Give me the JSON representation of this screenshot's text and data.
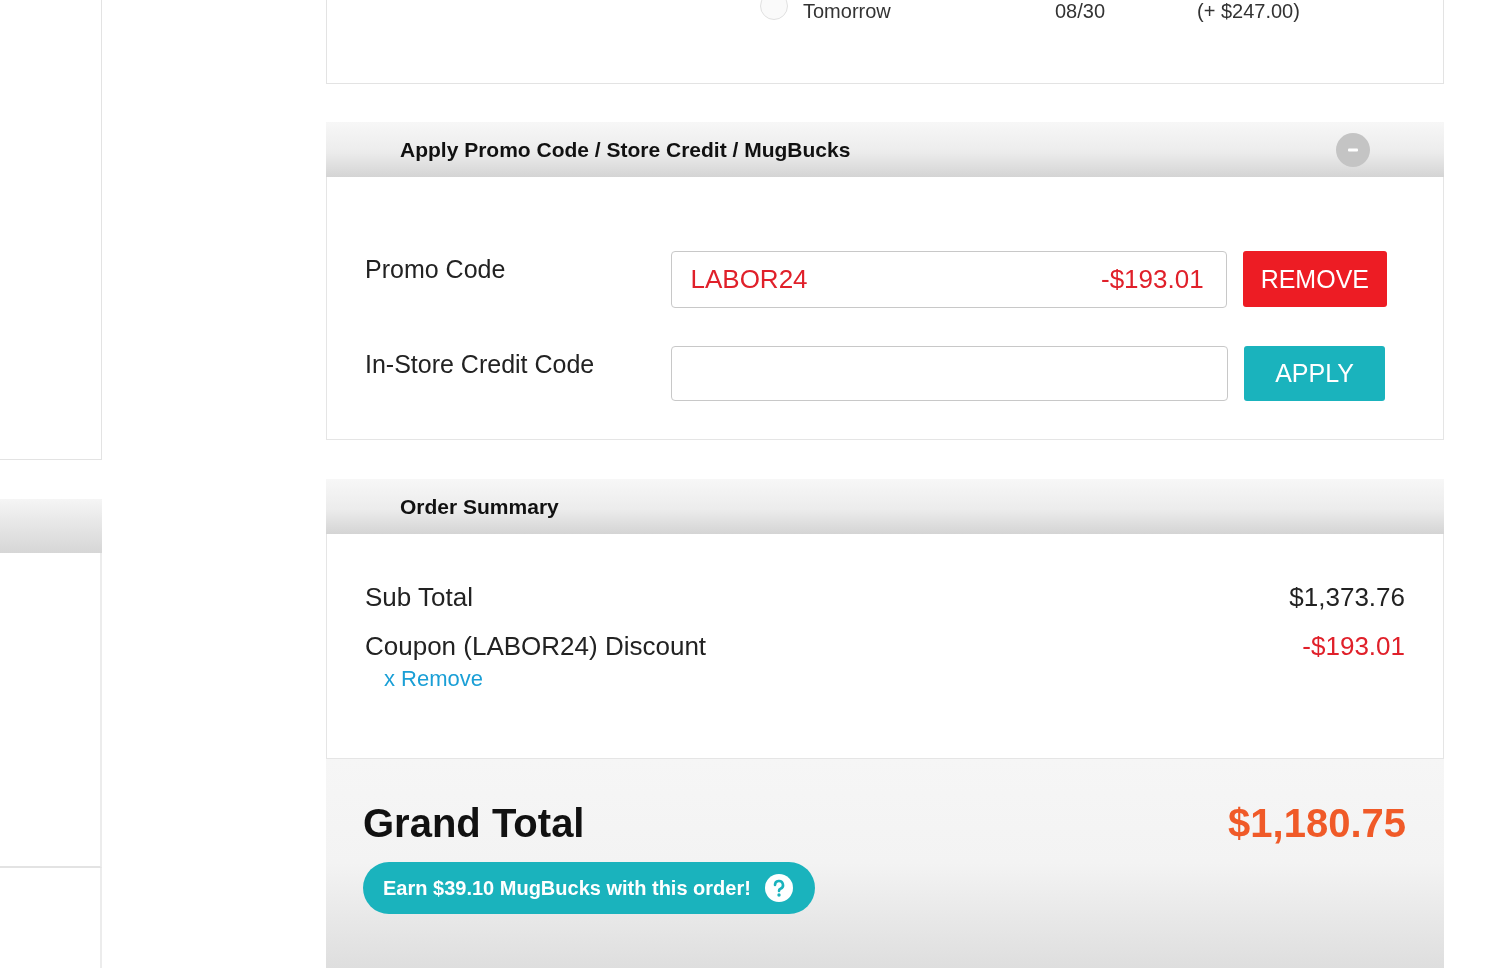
{
  "delivery_option": {
    "selected": false,
    "label": "Tomorrow",
    "date": "08/30",
    "price": "(+ $247.00)"
  },
  "promo_panel": {
    "title": "Apply Promo Code / Store Credit / MugBucks",
    "expanded": true,
    "rows": [
      {
        "kind": "applied",
        "label": "Promo Code",
        "value": "LABOR24",
        "amount": "-$193.01",
        "button": "REMOVE"
      },
      {
        "kind": "empty",
        "label": "In-Store Credit Code",
        "button": "APPLY"
      }
    ]
  },
  "order_summary": {
    "title": "Order Summary",
    "lines": [
      {
        "kind": "plain",
        "label": "Sub Total",
        "amount": "$1,373.76"
      },
      {
        "kind": "discount",
        "label": "Coupon (LABOR24) Discount",
        "amount": "-$193.01",
        "link": "x Remove"
      }
    ],
    "grand_total": {
      "label": "Grand Total",
      "amount": "$1,180.75"
    },
    "mugbucks_badge": "Earn $39.10 MugBucks with this order!"
  }
}
